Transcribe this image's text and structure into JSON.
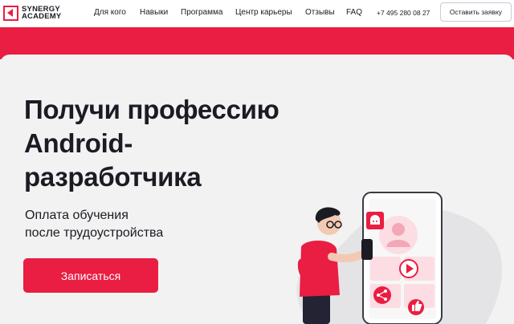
{
  "brand": {
    "line1": "SYNERGY",
    "line2": "ACADEMY",
    "accent_color": "#ea1d42"
  },
  "nav": {
    "items": [
      {
        "label": "Для кого"
      },
      {
        "label": "Навыки"
      },
      {
        "label": "Программа"
      },
      {
        "label": "Центр карьеры"
      },
      {
        "label": "Отзывы"
      },
      {
        "label": "FAQ"
      }
    ],
    "phone": "+7 495 280 08 27",
    "request_button": "Оставить заявку"
  },
  "hero": {
    "title_lines": [
      "Получи профессию",
      "Android-",
      "разработчика"
    ],
    "subtitle_lines": [
      "Оплата обучения",
      "после трудоустройства"
    ],
    "cta": "Записаться"
  },
  "illustration": {
    "icons": [
      "android-icon",
      "play-icon",
      "share-icon",
      "thumbs-up-icon"
    ]
  },
  "colors": {
    "background": "#f2f2f2",
    "text": "#1b1c23",
    "accent": "#ea1d42"
  }
}
